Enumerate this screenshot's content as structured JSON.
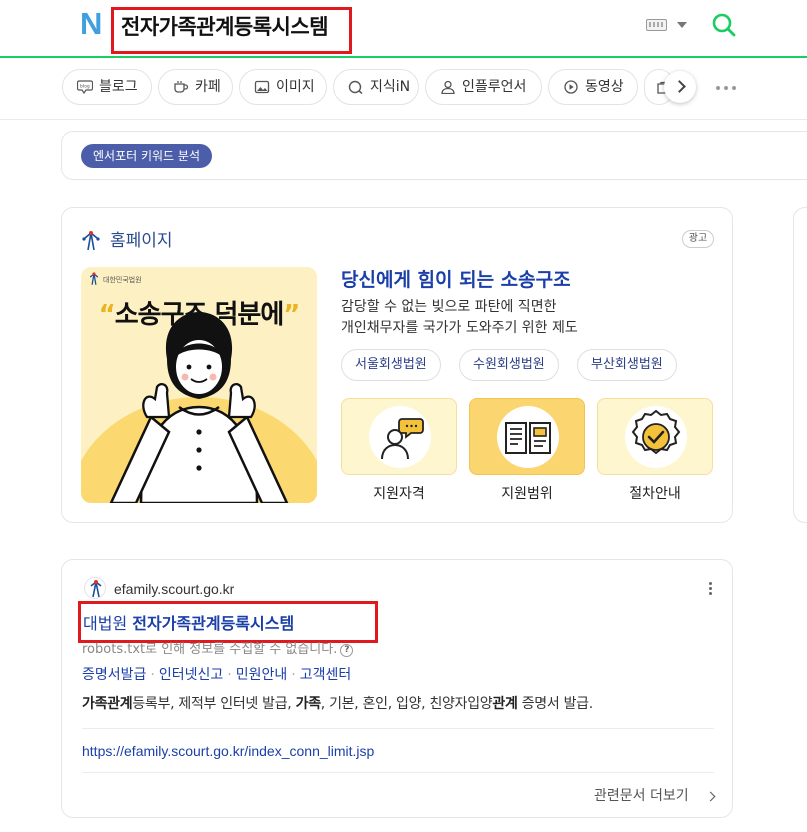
{
  "header": {
    "logo": "N",
    "query": "전자가족관계등록시스템"
  },
  "tabs": [
    {
      "label": "블로그",
      "icon": "blog-icon"
    },
    {
      "label": "카페",
      "icon": "cafe-icon"
    },
    {
      "label": "이미지",
      "icon": "image-icon"
    },
    {
      "label": "지식iN",
      "icon": "kin-icon"
    },
    {
      "label": "인플루언서",
      "icon": "person-icon"
    },
    {
      "label": "동영상",
      "icon": "play-icon"
    }
  ],
  "keyword_chip": "엔서포터 키워드 분석",
  "ad": {
    "section_label": "홈페이지",
    "badge": "광고",
    "image_logo_text": "대한민국법원",
    "image_headline": "소송구조 덕분에",
    "title": "당신에게 힘이 되는 소송구조",
    "desc_lines": [
      "감당할 수 없는 빚으로 파탄에 직면한",
      "개인채무자를 국가가 도와주기 위한 제도"
    ],
    "pills": [
      "서울회생법원",
      "수원회생법원",
      "부산회생법원"
    ],
    "tiles": [
      {
        "label": "지원자격",
        "icon": "person-chat-icon"
      },
      {
        "label": "지원범위",
        "icon": "book-icon"
      },
      {
        "label": "절차안내",
        "icon": "check-badge-icon"
      }
    ]
  },
  "result": {
    "site": "efamily.scourt.go.kr",
    "title_prefix": "대법원",
    "title_main": "전자가족관계등록시스템",
    "robots_note": "robots.txt로 인해 정보를 수집할 수 없습니다.",
    "sublinks": [
      "증명서발급",
      "인터넷신고",
      "민원안내",
      "고객센터"
    ],
    "snippet": {
      "b1": "가족관계",
      "t1": "등록부, 제적부 인터넷 발급, ",
      "b2": "가족",
      "t2": ", 기본, 혼인, 입양, 친양자입양",
      "b3": "관계",
      "t3": " 증명서 발급."
    },
    "url": "https://efamily.scourt.go.kr/index_conn_limit.jsp",
    "more_docs": "관련문서 더보기"
  },
  "colors": {
    "brand_green": "#19ce60",
    "link_blue": "#1b3fa8",
    "highlight_red": "#e0191f",
    "chip_purple": "#4c5ea9"
  }
}
